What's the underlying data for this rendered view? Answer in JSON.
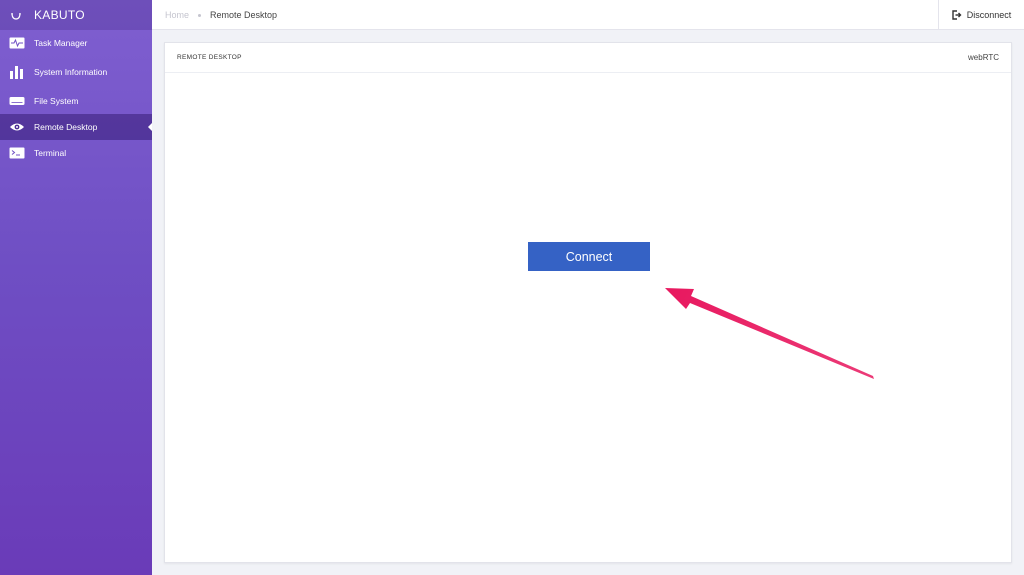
{
  "app": {
    "brand": "KABUTO"
  },
  "sidebar": {
    "items": [
      {
        "label": "Task Manager",
        "icon": "activity-icon"
      },
      {
        "label": "System Information",
        "icon": "bar-chart-icon"
      },
      {
        "label": "File System",
        "icon": "hard-drive-icon"
      },
      {
        "label": "Remote Desktop",
        "icon": "eye-icon",
        "active": true
      },
      {
        "label": "Terminal",
        "icon": "terminal-icon"
      }
    ]
  },
  "header": {
    "breadcrumb": {
      "home": "Home",
      "current": "Remote Desktop"
    },
    "disconnect_label": "Disconnect"
  },
  "panel": {
    "title": "REMOTE DESKTOP",
    "tag": "webRTC",
    "connect_label": "Connect"
  },
  "colors": {
    "sidebar": "#6f4fc4",
    "accent": "#3562c5",
    "annotation": "#e8185f"
  }
}
